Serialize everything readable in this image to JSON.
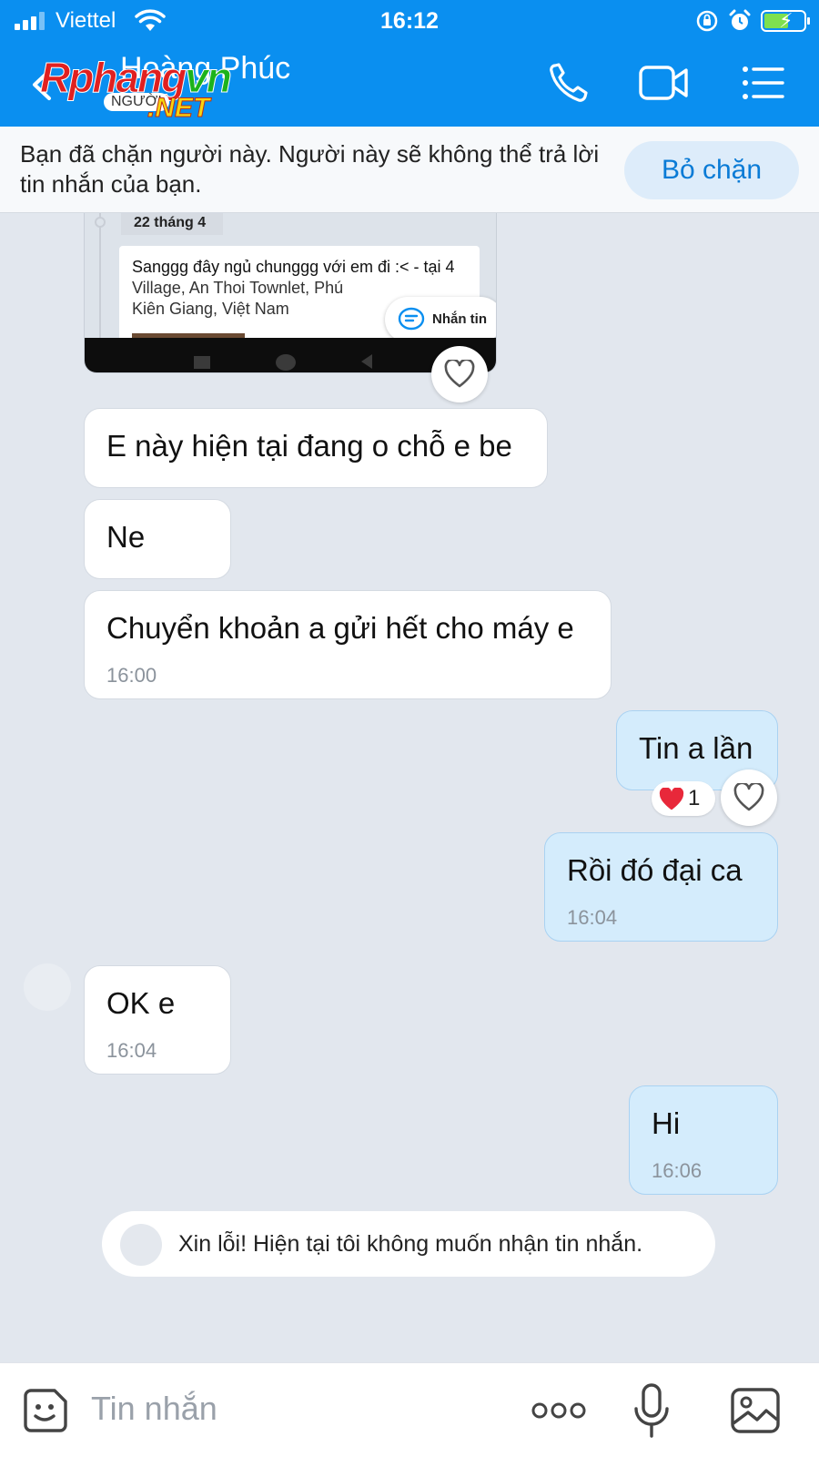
{
  "status_bar": {
    "carrier": "Viettel",
    "time": "16:12"
  },
  "header": {
    "contact_name": "Hoàng Phúc",
    "watermark": {
      "main_a": "Rphang",
      "main_b": "vn",
      "sub": "NGƯỜI",
      "net": ".NET"
    },
    "icons": [
      "back-icon",
      "phone-icon",
      "video-call-icon",
      "menu-list-icon"
    ]
  },
  "banner": {
    "text": "Bạn đã chặn người này. Người này sẽ không thể trả lời tin nhắn của bạn.",
    "unblock_label": "Bỏ chặn"
  },
  "shared_screenshot": {
    "date": "22 tháng 4",
    "line1": "Sanggg đây ngủ chunggg với em đi :< - tại 4",
    "line2": "Village, An Thoi Townlet, Phú",
    "line3": "Kiên Giang, Việt Nam",
    "button_label": "Nhắn tin"
  },
  "messages": [
    {
      "side": "in",
      "text": "E này hiện tại đang o chỗ e be",
      "time": ""
    },
    {
      "side": "in",
      "text": "Ne",
      "time": ""
    },
    {
      "side": "in",
      "text": "Chuyển khoản a gửi hết cho máy e",
      "time": "16:00"
    },
    {
      "side": "out",
      "text": "Tin a lần",
      "time": "",
      "reaction": {
        "emoji": "heart",
        "count": "1"
      }
    },
    {
      "side": "out",
      "text": "Rồi đó đại ca",
      "time": "16:04"
    },
    {
      "side": "in",
      "text": "OK e",
      "time": "16:04"
    },
    {
      "side": "out",
      "text": "Hi",
      "time": "16:06"
    }
  ],
  "auto_reply": {
    "text": "Xin lỗi! Hiện tại tôi không muốn nhận tin nhắn."
  },
  "input_bar": {
    "placeholder": "Tin nhắn",
    "icons": [
      "sticker-icon",
      "more-icon",
      "microphone-icon",
      "image-icon"
    ]
  },
  "colors": {
    "header": "#0a8ff0",
    "incoming_bubble": "#ffffff",
    "outgoing_bubble": "#d4ecfc",
    "chat_background": "#e2e7ee",
    "accent": "#0a7bd6"
  }
}
